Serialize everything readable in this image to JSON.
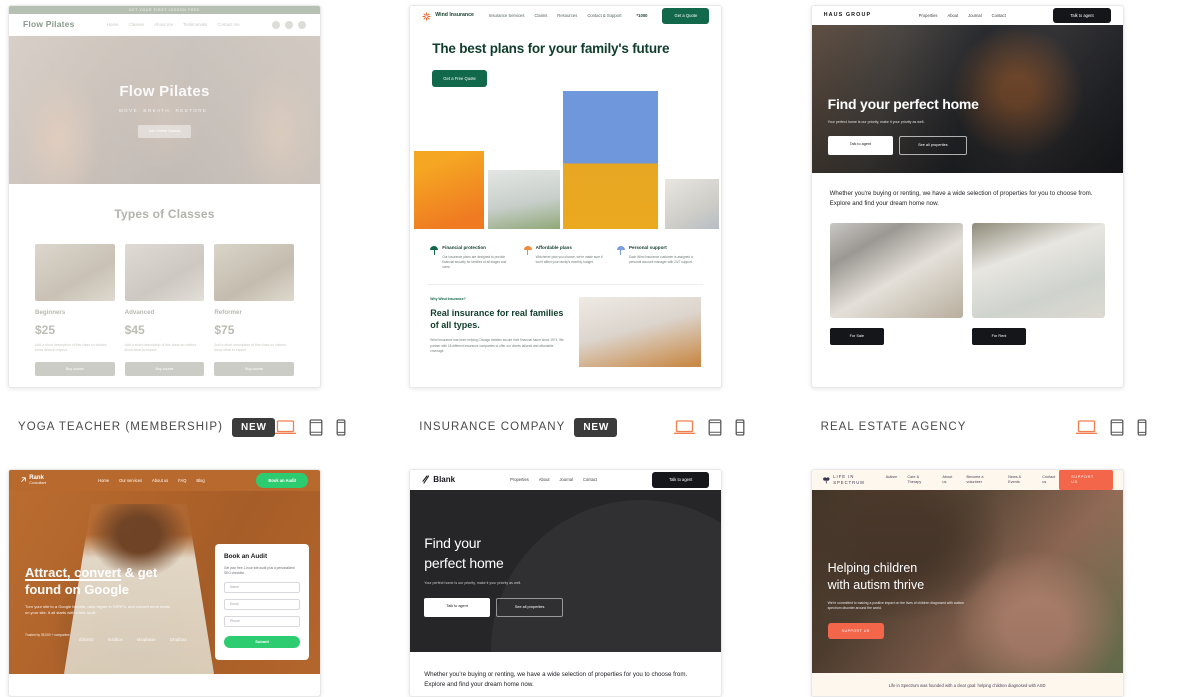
{
  "templates": [
    {
      "label": "YOGA TEACHER (MEMBERSHIP)",
      "badge": "NEW",
      "devices": [
        "desktop-icon",
        "tablet-icon",
        "mobile-icon"
      ],
      "site": {
        "announcement": "GET YOUR FIRST LESSON FREE",
        "logo": "Flow Pilates",
        "nav": [
          "Home",
          "Classes",
          "About me",
          "Testimonials",
          "Contact me"
        ],
        "hero_title": "Flow Pilates",
        "hero_subtitle": "MOVE. BREATH. RESTORE.",
        "hero_button": "Join Online Classes",
        "section_title": "Types of Classes",
        "classes": [
          {
            "name": "Beginners",
            "price": "$25",
            "desc": "Add a short description of this class so visitors know what to expect.",
            "button": "Buy course"
          },
          {
            "name": "Advanced",
            "price": "$45",
            "desc": "Add a short description of this class so visitors know what to expect.",
            "button": "Buy course"
          },
          {
            "name": "Reformer",
            "price": "$75",
            "desc": "Add a short description of this class so visitors know what to expect.",
            "button": "Buy course"
          }
        ]
      }
    },
    {
      "label": "INSURANCE COMPANY",
      "badge": "NEW",
      "devices": [
        "desktop-icon",
        "tablet-icon",
        "mobile-icon"
      ],
      "site": {
        "logo": "Wind Insurance",
        "nav": [
          "Insurance Services",
          "Claims",
          "Resources",
          "Contact & Support"
        ],
        "phone": "*1000",
        "nav_cta": "Get a Quote",
        "hero_title": "The best plans for your family's future",
        "hero_button": "Get a Free Quote",
        "features": [
          {
            "title": "Financial protection",
            "desc": "Our insurance plans are designed to provide financial security for families of all stages and sizes."
          },
          {
            "title": "Affordable plans",
            "desc": "Whichever plan you choose, we're made sure it won't affect your family's monthly budget."
          },
          {
            "title": "Personal support",
            "desc": "Each Wind Insurance customer is assigned a personal account manager with 24/7 support."
          }
        ],
        "why_kicker": "Why Wind Insurance?",
        "why_title": "Real insurance for real families of all types.",
        "why_text": "Wind Insurance has been helping Chicago families secure their financial future since 1974. We partner with 18 different insurance companies to offer our clients tailored and affordable coverage."
      }
    },
    {
      "label": "REAL ESTATE AGENCY",
      "badge": "",
      "devices": [
        "desktop-icon",
        "tablet-icon",
        "mobile-icon"
      ],
      "site": {
        "logo": "HAUS GROUP",
        "nav": [
          "Properties",
          "About",
          "Journal",
          "Contact"
        ],
        "nav_cta": "Talk to agent",
        "hero_title": "Find your perfect home",
        "hero_subtitle": "Your perfect home is our priority, make it your priority as well.",
        "hero_button_1": "Talk to agent",
        "hero_button_2": "See all properties",
        "body_text": "Whether you're buying or renting, we have a wide selection of properties for you to choose from. Explore and find your dream home now.",
        "tags": [
          "For Sale",
          "For Rent"
        ]
      }
    },
    {
      "label": "",
      "badge": "",
      "devices": [],
      "site": {
        "logo_main": "Rank",
        "logo_sub": "Consultant",
        "nav": [
          "Home",
          "Our services",
          "About us",
          "FAQ",
          "Blog"
        ],
        "nav_cta": "Book an Audit",
        "hero_title_1": "Attract, convert",
        "hero_title_2": "& get",
        "hero_title_3": "found on Google",
        "hero_subtitle": "Turn your site to a Google favorite, rank higher in SERPs, and convert more leads on your site. It all starts with a free audit.",
        "trusted": "Trusted by 35,000 + companies",
        "brand_logos": [
          "dotomb",
          "mailbox",
          "shopbase",
          "Dropbox"
        ],
        "form_title": "Book an Audit",
        "form_desc": "Get your free 1-hour site audit plus a personalized SEO checklist.",
        "fields": [
          "Name",
          "Email",
          "Phone"
        ],
        "submit": "Submit"
      }
    },
    {
      "label": "",
      "badge": "",
      "devices": [],
      "site": {
        "logo": "Blank",
        "nav": [
          "Properties",
          "About",
          "Journal",
          "Contact"
        ],
        "nav_cta": "Talk to agent",
        "hero_title_1": "Find your",
        "hero_title_2": "perfect home",
        "hero_subtitle": "Your perfect home is our priority, make it your priority as well.",
        "hero_button_1": "Talk to agent",
        "hero_button_2": "See all properties",
        "body_text": "Whether you're buying or renting, we have a wide selection of properties for you to choose from. Explore and find your dream home now."
      }
    },
    {
      "label": "",
      "badge": "",
      "devices": [],
      "site": {
        "logo": "LIFE IN SPECTRUM",
        "nav": [
          "Autism",
          "Care & Therapy",
          "About us",
          "Become a volunteer",
          "News & Events",
          "Contact us"
        ],
        "nav_cta": "SUPPORT US",
        "hero_title_1": "Helping children",
        "hero_title_2": "with autism thrive",
        "hero_subtitle": "We're committed to making a positive impact on the lives of children diagnosed with autism spectrum disorder around the world.",
        "hero_button": "SUPPORT US",
        "footer_text": "Life in Spectrum was founded with a clear goal: helping children diagnosed with ASD"
      }
    }
  ],
  "colors": {
    "accent_orange": "#ef7f4f",
    "badge_bg": "#3b3b3b",
    "insurance_green": "#12684a",
    "seo_green": "#2ecc71",
    "charity_coral": "#f4664a",
    "rank_brown": "#b86a2e"
  }
}
